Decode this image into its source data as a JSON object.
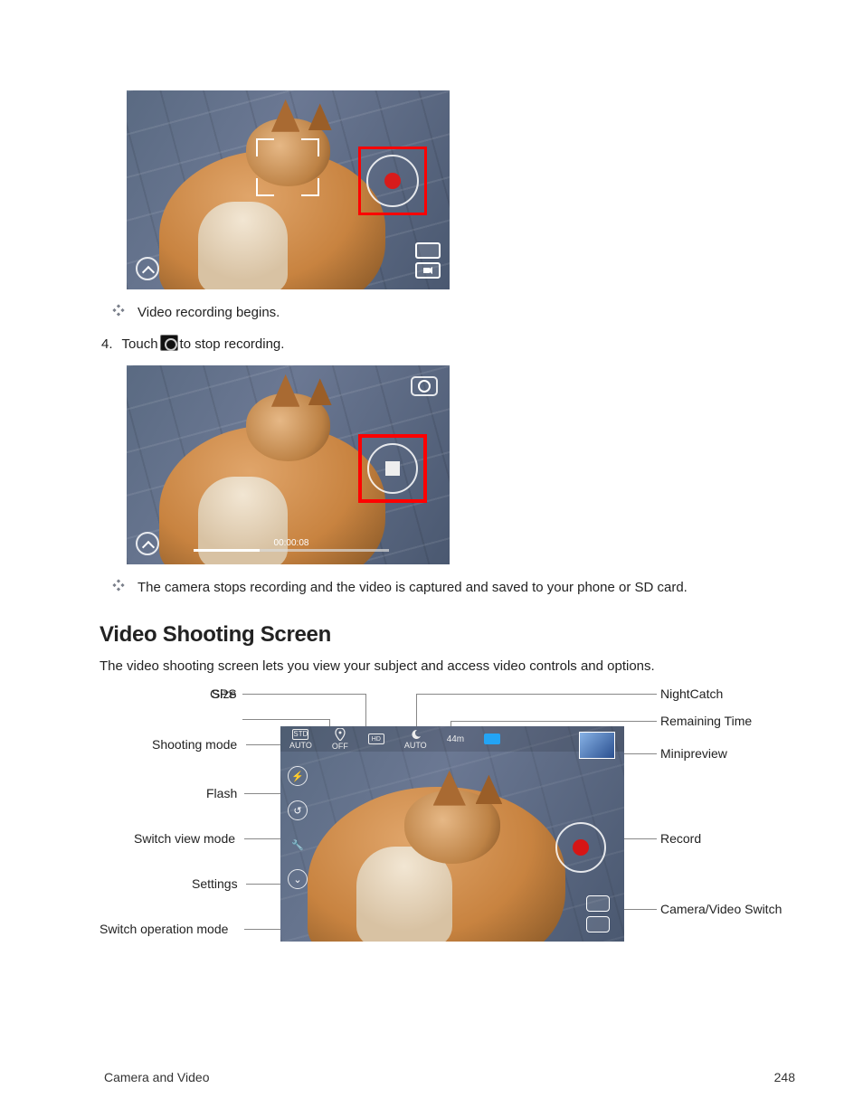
{
  "bullets": {
    "begins": "Video recording begins.",
    "stops": "The camera stops recording and the video is captured and saved to your phone or SD card."
  },
  "step": {
    "num": "4.",
    "before": "Touch",
    "after": "to stop recording."
  },
  "screenshot2": {
    "timer": "00:00:08"
  },
  "section": {
    "heading": "Video Shooting Screen",
    "intro": "The video shooting screen lets you view your subject and access video controls and options."
  },
  "diagram": {
    "topbar": {
      "mode": "STD",
      "mode_sub": "AUTO",
      "gps": "OFF",
      "size": "HD",
      "night": "AUTO",
      "remaining": "44m"
    },
    "labels": {
      "size": "Size",
      "gps": "GPS",
      "shooting_mode": "Shooting mode",
      "flash": "Flash",
      "switch_view": "Switch view mode",
      "settings": "Settings",
      "switch_op": "Switch operation mode",
      "nightcatch": "NightCatch",
      "remaining_time": "Remaining Time",
      "minipreview": "Minipreview",
      "record": "Record",
      "cam_video_switch": "Camera/Video Switch"
    }
  },
  "footer": {
    "section": "Camera and Video",
    "page": "248"
  }
}
